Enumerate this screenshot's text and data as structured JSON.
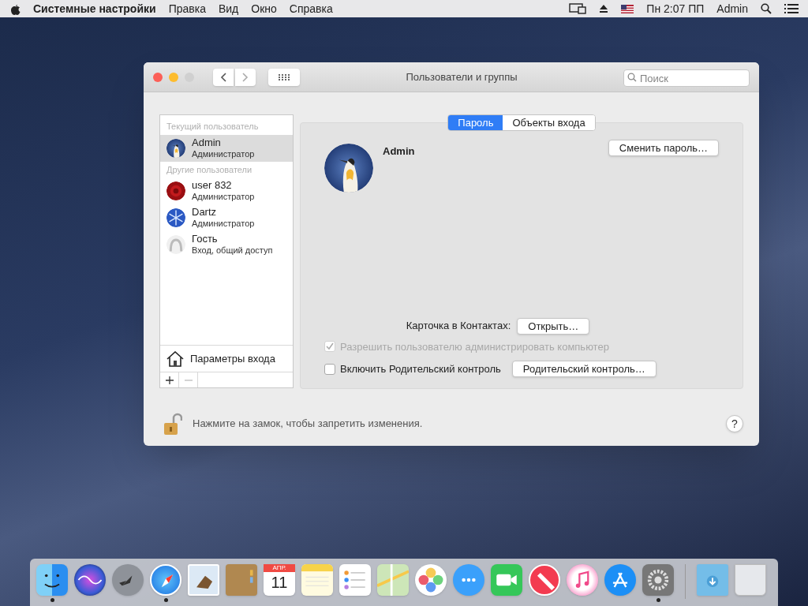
{
  "menu_bar": {
    "app": "Системные настройки",
    "menus": [
      "Правка",
      "Вид",
      "Окно",
      "Справка"
    ],
    "clock": "Пн 2:07 ПП",
    "user": "Admin"
  },
  "window": {
    "title": "Пользователи и группы",
    "search": {
      "placeholder": "Поиск"
    },
    "sidebar": {
      "sections": [
        {
          "heading": "Текущий пользователь",
          "users": [
            {
              "name": "Admin",
              "role": "Администратор",
              "kind": "penguin",
              "selected": true
            }
          ]
        },
        {
          "heading": "Другие пользователи",
          "users": [
            {
              "name": "user 832",
              "role": "Администратор",
              "kind": "rose",
              "selected": false
            },
            {
              "name": "Dartz",
              "role": "Администратор",
              "kind": "snowflake",
              "selected": false
            },
            {
              "name": "Гость",
              "role": "Вход, общий доступ",
              "kind": "guest",
              "selected": false
            }
          ]
        }
      ],
      "login_options": "Параметры входа"
    },
    "tabs": [
      {
        "label": "Пароль",
        "selected": true
      },
      {
        "label": "Объекты входа",
        "selected": false
      }
    ],
    "user_name": "Admin",
    "change_password": "Сменить пароль…",
    "contacts_label": "Карточка в Контактах:",
    "open_button": "Открыть…",
    "options": [
      {
        "label": "Разрешить пользователю администрировать компьютер",
        "checked": true,
        "disabled": true
      },
      {
        "label": "Включить Родительский контроль",
        "checked": false,
        "disabled": false
      }
    ],
    "parental_button": "Родительский контроль…",
    "lock_text": "Нажмите на замок, чтобы запретить изменения.",
    "help": "?"
  },
  "dock": [
    {
      "kind": "finder",
      "running": true
    },
    {
      "kind": "siri"
    },
    {
      "kind": "launchpad"
    },
    {
      "kind": "safari",
      "running": true
    },
    {
      "kind": "mail"
    },
    {
      "kind": "contacts"
    },
    {
      "kind": "calendar",
      "month": "АПР.",
      "day": "11"
    },
    {
      "kind": "notes"
    },
    {
      "kind": "reminders"
    },
    {
      "kind": "maps"
    },
    {
      "kind": "photos"
    },
    {
      "kind": "messages"
    },
    {
      "kind": "facetime"
    },
    {
      "kind": "news"
    },
    {
      "kind": "music"
    },
    {
      "kind": "appstore"
    },
    {
      "kind": "settings",
      "running": true
    },
    {
      "kind": "separator"
    },
    {
      "kind": "downloads"
    },
    {
      "kind": "trash"
    }
  ]
}
